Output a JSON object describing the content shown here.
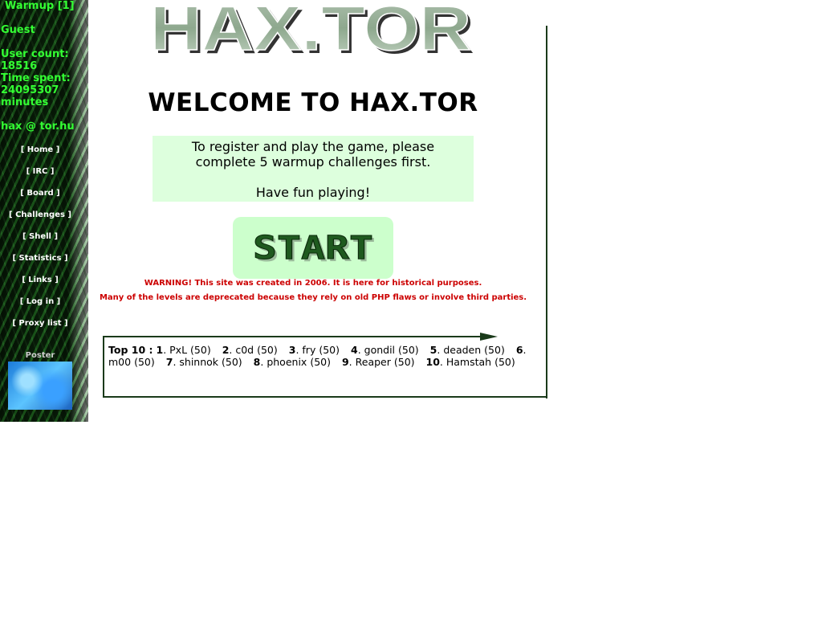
{
  "sidebar": {
    "title": "Warmup [1]",
    "user": "Guest",
    "user_count_label": "User count:",
    "user_count": "18516",
    "time_spent_label": "Time spent:",
    "time_spent_value": "24095307",
    "time_spent_unit": "minutes",
    "contact": "hax @ tor.hu",
    "nav": [
      {
        "label": "[ Home ]"
      },
      {
        "label": "[ IRC ]"
      },
      {
        "label": "[ Board ]"
      },
      {
        "label": "[ Challenges ]"
      },
      {
        "label": "[ Shell ]"
      },
      {
        "label": "[ Statistics ]"
      },
      {
        "label": "[ Links ]"
      },
      {
        "label": "[ Log in ]"
      },
      {
        "label": "[ Proxy list ]"
      }
    ],
    "poster_label": "Poster"
  },
  "logo": "HAX.TOR",
  "welcome": "WELCOME TO HAX.TOR",
  "info": {
    "line1": "To register and play the game, please",
    "line2": "complete 5 warmup challenges first.",
    "line3": "Have fun playing!"
  },
  "start_button": "START",
  "warning1": "WARNING! This site was created in 2006. It is here for historical purposes.",
  "warning2": "Many of the levels are deprecated because they rely on old PHP flaws or involve third parties.",
  "top10": {
    "label": "Top 10 :",
    "entries": [
      {
        "rank": "1",
        "name": "PxL",
        "score": "(50)"
      },
      {
        "rank": "2",
        "name": "c0d",
        "score": "(50)"
      },
      {
        "rank": "3",
        "name": "fry",
        "score": "(50)"
      },
      {
        "rank": "4",
        "name": "gondil",
        "score": "(50)"
      },
      {
        "rank": "5",
        "name": "deaden",
        "score": "(50)"
      },
      {
        "rank": "6",
        "name": "m00",
        "score": "(50)"
      },
      {
        "rank": "7",
        "name": "shinnok",
        "score": "(50)"
      },
      {
        "rank": "8",
        "name": "phoenix",
        "score": "(50)"
      },
      {
        "rank": "9",
        "name": "Reaper",
        "score": "(50)"
      },
      {
        "rank": "10",
        "name": "Hamstah",
        "score": "(50)"
      }
    ]
  }
}
